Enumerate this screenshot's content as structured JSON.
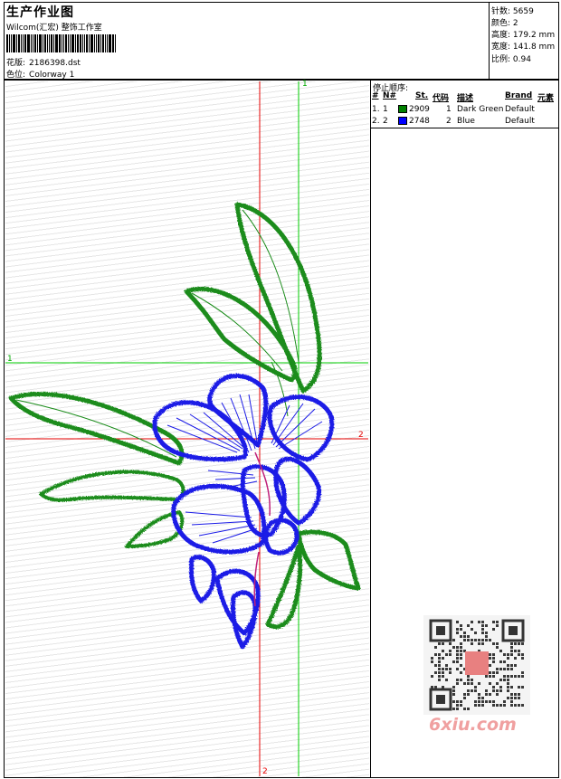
{
  "header": {
    "title": "生产作业图",
    "company": "Wilcom(汇宏) 整饰工作室",
    "design_label": "花版:",
    "design_value": "2186398.dst",
    "colorway_label": "色位:",
    "colorway_value": "Colorway 1"
  },
  "stats": [
    {
      "label": "针数:",
      "value": "5659"
    },
    {
      "label": "颜色:",
      "value": "2"
    },
    {
      "label": "高度:",
      "value": "179.2 mm"
    },
    {
      "label": "宽度:",
      "value": "141.8 mm"
    },
    {
      "label": "比例:",
      "value": "0.94"
    }
  ],
  "stop_sequence": {
    "title": "停止顺序:",
    "columns": [
      "#",
      "N#",
      "St.",
      "代码",
      "描述",
      "Brand",
      "元素"
    ],
    "rows": [
      {
        "num": "1.",
        "n": "1",
        "st": "2909",
        "code": "1",
        "desc": "Dark Green",
        "brand": "Default",
        "color": "#008000"
      },
      {
        "num": "2.",
        "n": "2",
        "st": "2748",
        "code": "2",
        "desc": "Blue",
        "brand": "Default",
        "color": "#0000ff"
      }
    ]
  },
  "axes": {
    "top_label": "1",
    "left_label": "1",
    "right_label": "2",
    "bottom_label": "2"
  },
  "thread_colors": {
    "green": "#1a8c1a",
    "blue": "#1a1ae6",
    "red_axis": "#e60000",
    "green_axis": "#00cc00"
  },
  "watermark": {
    "text": "6xiu.com"
  }
}
